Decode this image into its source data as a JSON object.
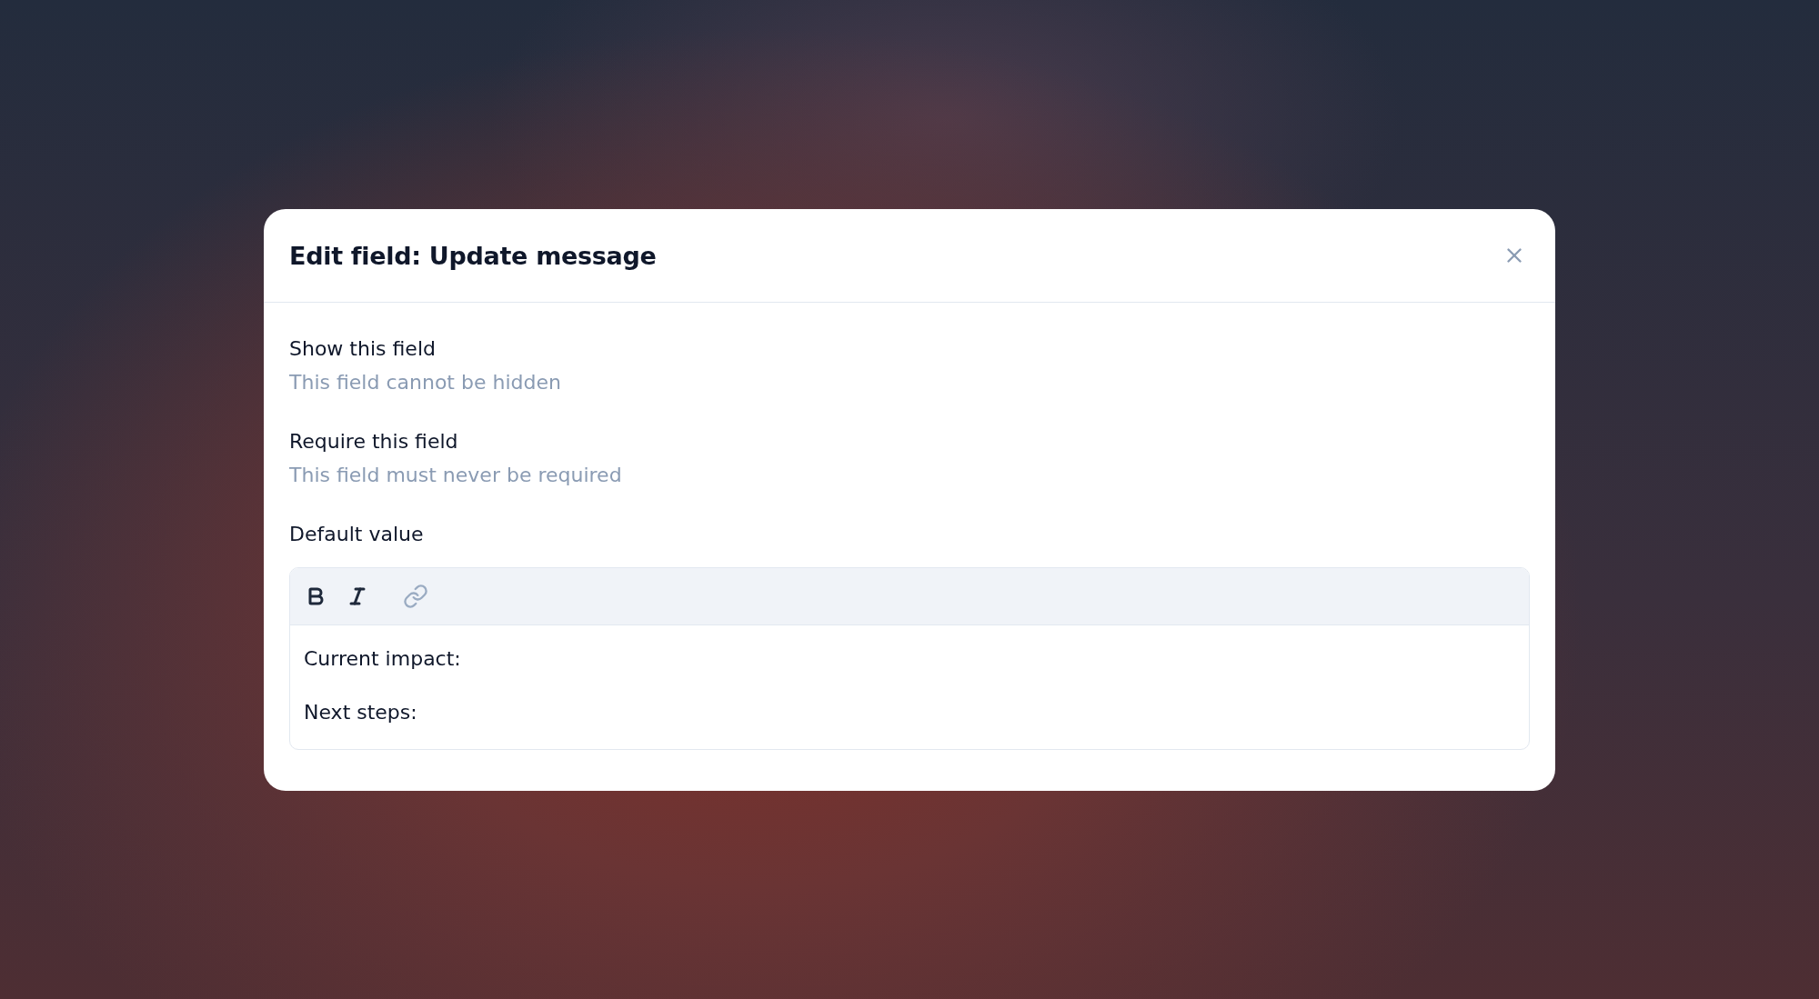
{
  "dialog": {
    "title": "Edit field: Update message",
    "settings": [
      {
        "label": "Show this field",
        "note": "This field cannot be hidden"
      },
      {
        "label": "Require this field",
        "note": "This field must never be required"
      }
    ],
    "default_value": {
      "label": "Default value",
      "toolbar": [
        {
          "kind": "bold",
          "disabled": false
        },
        {
          "kind": "italic",
          "disabled": false
        },
        {
          "kind": "link",
          "disabled": true
        }
      ],
      "lines": [
        "Current impact:",
        "Next steps:"
      ]
    }
  }
}
